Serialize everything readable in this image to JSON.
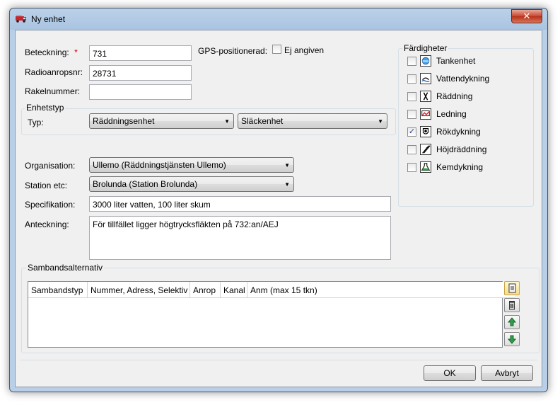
{
  "window": {
    "title": "Ny enhet",
    "close_glyph": "✕"
  },
  "form": {
    "beteckning_label": "Beteckning:",
    "required_marker": "*",
    "beteckning_value": "731",
    "radio_label": "Radioanropsnr:",
    "radio_value": "28731",
    "rakel_label": "Rakelnummer:",
    "rakel_value": "",
    "gps_label": "GPS-positionerad:",
    "gps_checkbox_label": "Ej angiven",
    "gps_checked": false
  },
  "enhetstyp": {
    "group_title": "Enhetstyp",
    "typ_label": "Typ:",
    "typ_value": "Räddningsenhet",
    "subtyp_value": "Släckenhet"
  },
  "details": {
    "organisation_label": "Organisation:",
    "organisation_value": "Ullemo (Räddningstjänsten Ullemo)",
    "station_label": "Station etc:",
    "station_value": "Brolunda (Station Brolunda)",
    "spec_label": "Specifikation:",
    "spec_value": "3000 liter vatten, 100 liter skum",
    "note_label": "Anteckning:",
    "note_value": "För tillfället ligger högtrycksfläkten på 732:an/AEJ"
  },
  "skills": {
    "group_title": "Färdigheter",
    "items": [
      {
        "label": "Tankenhet",
        "checked": false,
        "icon": "tank-icon"
      },
      {
        "label": "Vattendykning",
        "checked": false,
        "icon": "water-diving-icon"
      },
      {
        "label": "Räddning",
        "checked": false,
        "icon": "rescue-icon"
      },
      {
        "label": "Ledning",
        "checked": false,
        "icon": "command-icon"
      },
      {
        "label": "Rökdykning",
        "checked": true,
        "icon": "smoke-diving-icon"
      },
      {
        "label": "Höjdräddning",
        "checked": false,
        "icon": "height-rescue-icon"
      },
      {
        "label": "Kemdykning",
        "checked": false,
        "icon": "chemical-diving-icon"
      }
    ]
  },
  "comms": {
    "group_title": "Sambandsalternativ",
    "columns": [
      "Sambandstyp",
      "Nummer, Adress, Selektiv",
      "Anrop",
      "Kanal",
      "Anm (max 15 tkn)"
    ]
  },
  "buttons": {
    "ok": "OK",
    "cancel": "Avbryt"
  },
  "colors": {
    "required": "#cc0000",
    "accent": "#2a3f8a"
  }
}
